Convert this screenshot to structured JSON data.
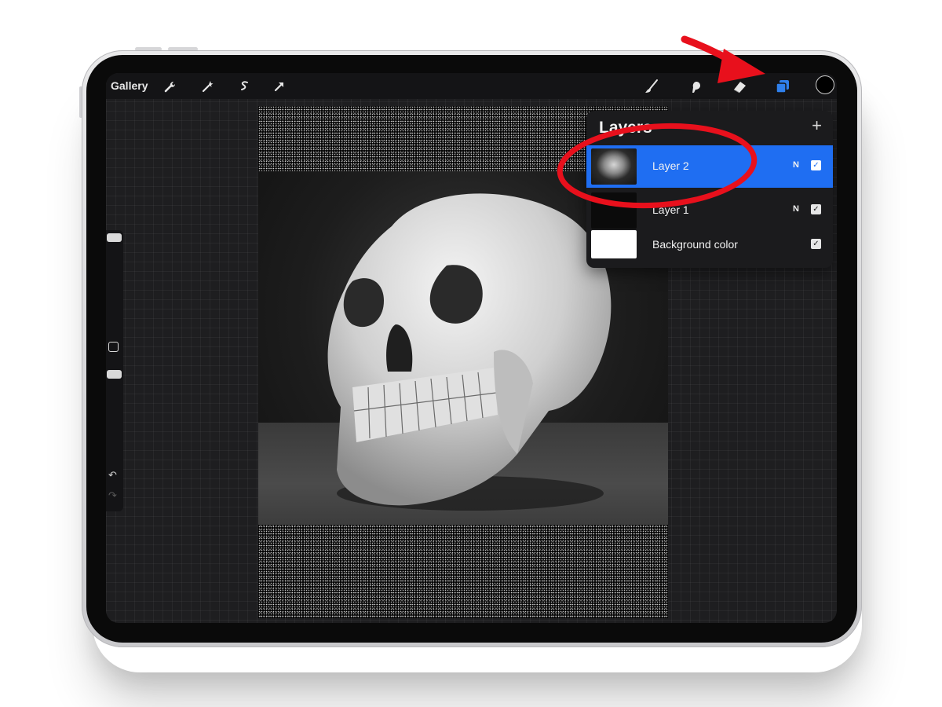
{
  "topbar": {
    "gallery_label": "Gallery",
    "left_tools": [
      "wrench-icon",
      "magic-wand-icon",
      "selection-s-icon",
      "transform-arrow-icon"
    ],
    "right_tools": [
      "brush-icon",
      "smudge-icon",
      "eraser-icon",
      "layers-icon",
      "color-picker-icon"
    ],
    "layers_icon_color": "#2f80ed",
    "current_color": "#000000"
  },
  "layers_panel": {
    "title": "Layers",
    "add_symbol": "+",
    "layers": [
      {
        "name": "Layer 2",
        "blend_mode": "N",
        "visible": true,
        "selected": true,
        "check": "✓"
      },
      {
        "name": "Layer 1",
        "blend_mode": "N",
        "visible": true,
        "selected": false,
        "check": "✓"
      },
      {
        "name": "Background color",
        "blend_mode": "",
        "visible": true,
        "selected": false,
        "check": "✓"
      }
    ],
    "selection_color": "#1f6ef2"
  },
  "sidebar": {
    "undo_symbol": "↶",
    "redo_symbol": "↷"
  },
  "annotation": {
    "color": "#e8101c",
    "shapes": [
      "arrow-pointing-to-layers-icon",
      "circle-around-layer-2"
    ]
  }
}
